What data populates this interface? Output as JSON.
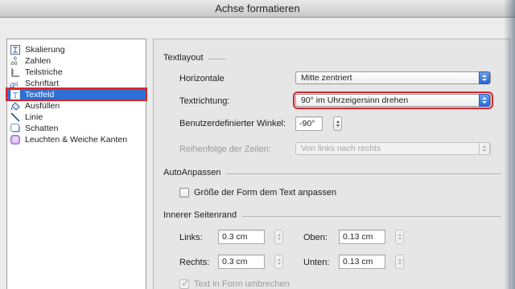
{
  "window": {
    "title": "Achse formatieren"
  },
  "sidebar": {
    "items": [
      {
        "label": "Skalierung",
        "icon": "scaling-icon"
      },
      {
        "label": "Zahlen",
        "icon": "number-format-icon"
      },
      {
        "label": "Teilstriche",
        "icon": "tick-marks-icon"
      },
      {
        "label": "Schriftart",
        "icon": "font-icon"
      },
      {
        "label": "Textfeld",
        "icon": "textbox-icon",
        "selected": true
      },
      {
        "label": "Ausfüllen",
        "icon": "fill-bucket-icon"
      },
      {
        "label": "Linie",
        "icon": "line-icon"
      },
      {
        "label": "Schatten",
        "icon": "shadow-icon"
      },
      {
        "label": "Leuchten & Weiche Kanten",
        "icon": "glow-soft-edges-icon"
      }
    ]
  },
  "textlayout": {
    "section_title": "Textlayout",
    "horizontal_label": "Horizontale",
    "horizontal_value": "Mitte zentriert",
    "direction_label": "Textrichtung:",
    "direction_value": "90° im Uhrzeigersinn drehen",
    "angle_label": "Benutzerdefinierter Winkel:",
    "angle_value": "-90°",
    "row_order_label": "Reihenfolge der Zeilen:",
    "row_order_value": "Von links nach rechts"
  },
  "autofit": {
    "section_title": "AutoAnpassen",
    "resize_label": "Größe der Form dem Text anpassen",
    "resize_checked": false
  },
  "margins": {
    "section_title": "Innerer Seitenrand",
    "left_label": "Links:",
    "left_value": "0.3 cm",
    "top_label": "Oben:",
    "top_value": "0.13 cm",
    "right_label": "Rechts:",
    "right_value": "0.3 cm",
    "bottom_label": "Unten:",
    "bottom_value": "0.13 cm",
    "wrap_label": "Text in Form umbrechen",
    "wrap_checked": true
  },
  "colors": {
    "selection": "#2f6fd1",
    "highlight": "#d9252b",
    "popup_arrows": "#2a66d2"
  }
}
